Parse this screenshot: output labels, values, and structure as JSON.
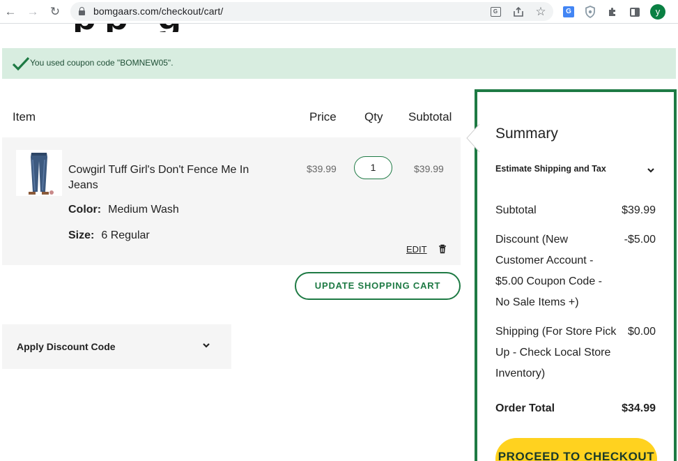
{
  "browser": {
    "url": "bomgaars.com/checkout/cart/",
    "avatar_letter": "y",
    "avatar_color": "#0a8043"
  },
  "notice": {
    "message": "You used coupon code \"BOMNEW05\"."
  },
  "cart": {
    "headers": {
      "item": "Item",
      "price": "Price",
      "qty": "Qty",
      "subtotal": "Subtotal"
    },
    "items": [
      {
        "name": "Cowgirl Tuff Girl's Don't Fence Me In Jeans",
        "options": [
          {
            "label": "Color:",
            "value": "Medium Wash"
          },
          {
            "label": "Size:",
            "value": "6 Regular"
          }
        ],
        "price": "$39.99",
        "qty": "1",
        "subtotal": "$39.99",
        "edit_label": "EDIT"
      }
    ],
    "update_button": "UPDATE SHOPPING CART",
    "discount_toggle": "Apply Discount Code"
  },
  "summary": {
    "title": "Summary",
    "estimate_label": "Estimate Shipping and Tax",
    "subtotal_label": "Subtotal",
    "subtotal_value": "$39.99",
    "discount_label": "Discount (New Customer Account - $5.00 Coupon Code - No Sale Items +)",
    "discount_value": "-$5.00",
    "shipping_label": "Shipping (For Store Pick Up - Check Local Store Inventory)",
    "shipping_value": "$0.00",
    "total_label": "Order Total",
    "total_value": "$34.99",
    "checkout_button": "PROCEED TO CHECKOUT"
  },
  "colors": {
    "brand_green": "#1e7a44",
    "notice_bg": "#d8ede0",
    "checkout_yellow": "#ffd21f"
  }
}
